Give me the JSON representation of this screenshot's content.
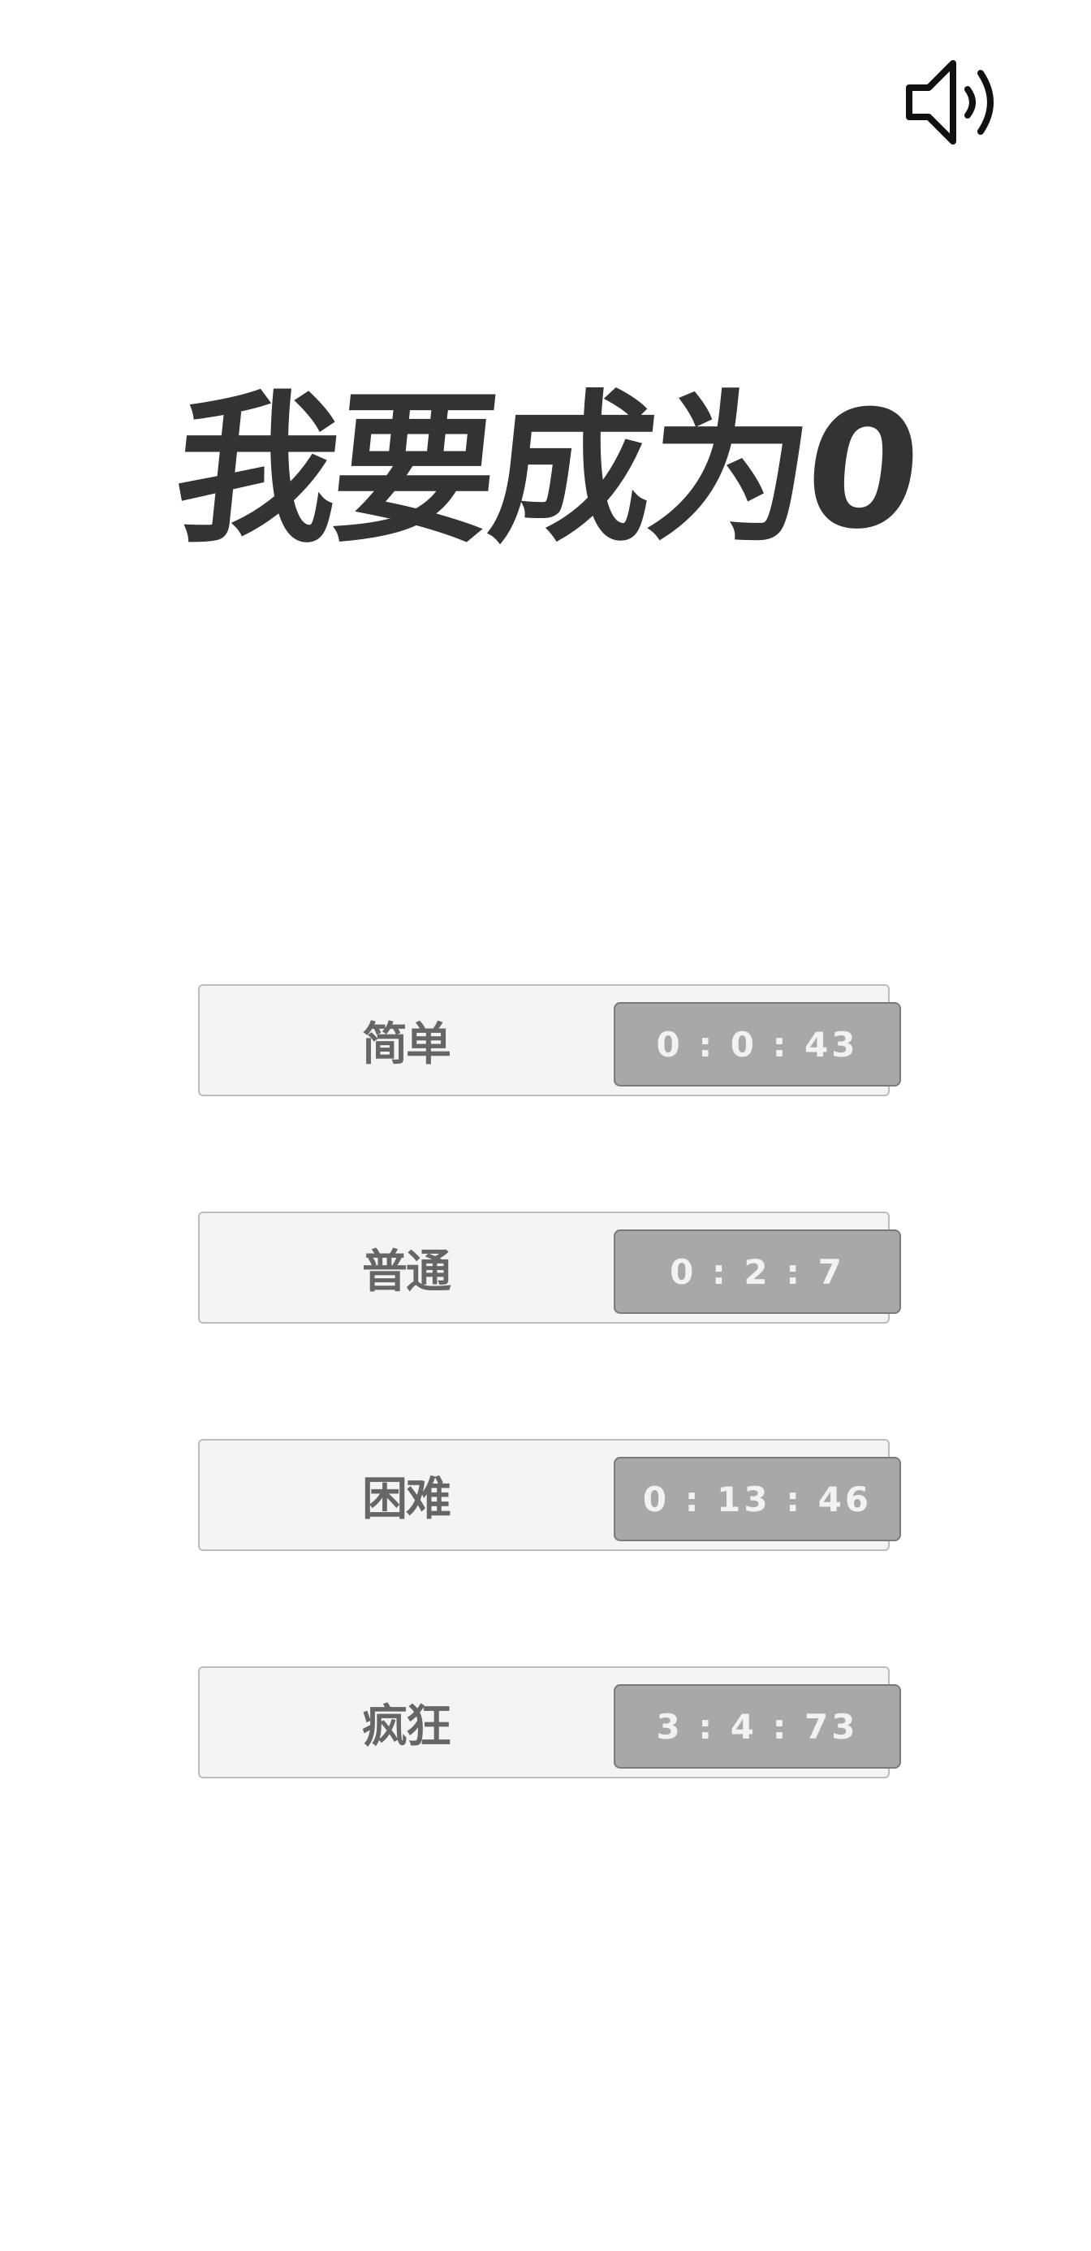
{
  "header": {
    "sound_icon": "speaker-on-icon"
  },
  "title": "我要成为0",
  "levels": [
    {
      "label": "简单",
      "best_time": "0 : 0 : 43"
    },
    {
      "label": "普通",
      "best_time": "0 : 2 : 7"
    },
    {
      "label": "困难",
      "best_time": "0 : 13 : 46"
    },
    {
      "label": "疯狂",
      "best_time": "3 : 4 : 73"
    }
  ],
  "colors": {
    "title": "#333333",
    "card_bg": "#f4f4f4",
    "card_border": "#bdbdbd",
    "label": "#666666",
    "time_bg": "#a8a8a8",
    "time_text": "#f2f2f2"
  }
}
